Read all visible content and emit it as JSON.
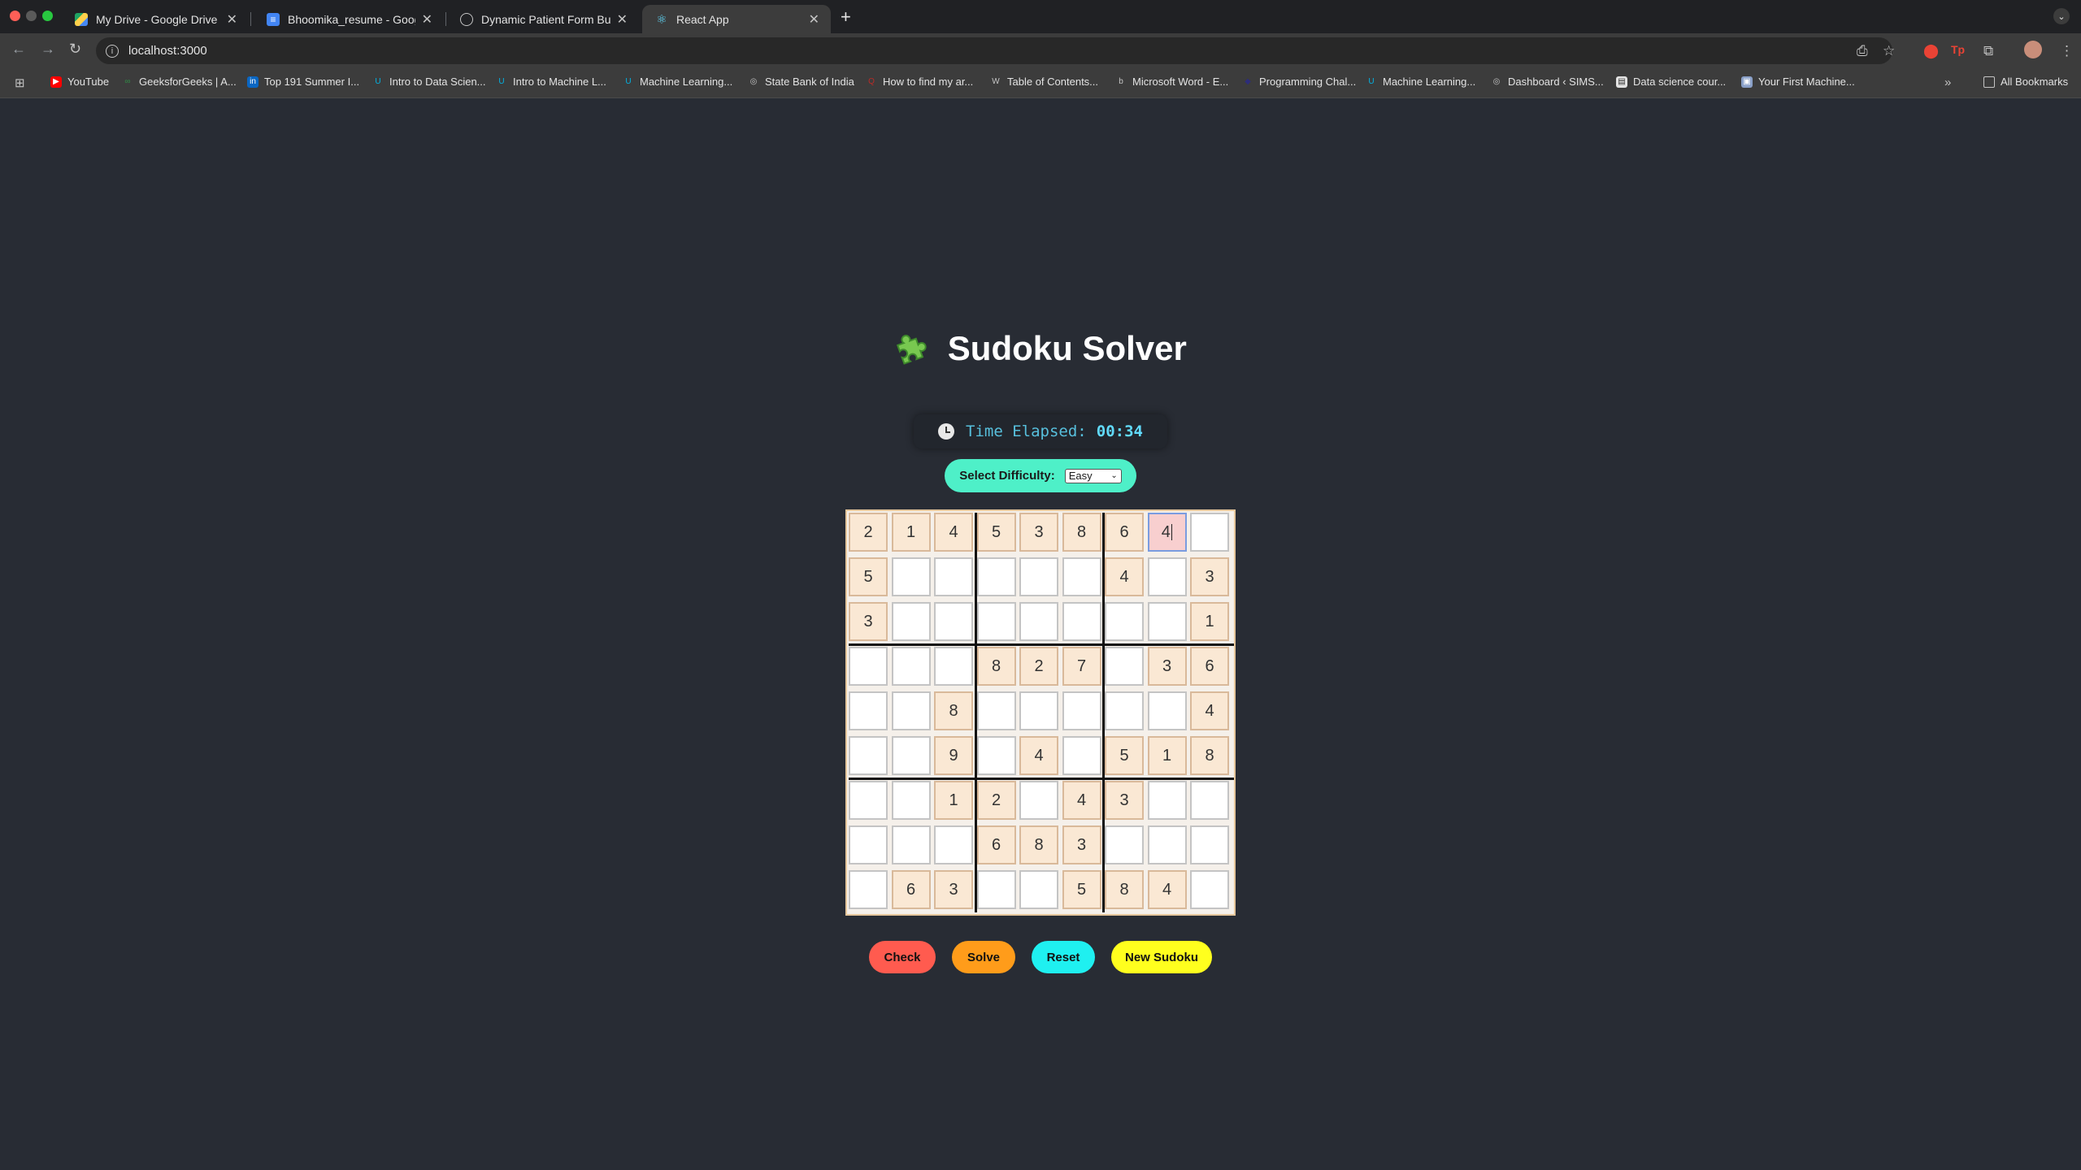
{
  "browser": {
    "tabs": [
      {
        "title": "My Drive - Google Drive",
        "icon": "google-drive-icon"
      },
      {
        "title": "Bhoomika_resume - Google D",
        "icon": "google-docs-icon"
      },
      {
        "title": "Dynamic Patient Form Builder",
        "icon": "globe-icon"
      },
      {
        "title": "React App",
        "icon": "react-icon",
        "active": true
      }
    ],
    "url": "localhost:3000",
    "bookmarks": [
      {
        "label": "YouTube",
        "icon": "youtube-icon"
      },
      {
        "label": "GeeksforGeeks | A...",
        "icon": "gfg-icon"
      },
      {
        "label": "Top 191 Summer I...",
        "icon": "linkedin-icon"
      },
      {
        "label": "Intro to Data Scien...",
        "icon": "udacity-icon"
      },
      {
        "label": "Intro to Machine L...",
        "icon": "udacity-icon"
      },
      {
        "label": "Machine Learning...",
        "icon": "udacity-icon"
      },
      {
        "label": "State Bank of India",
        "icon": "globe-icon"
      },
      {
        "label": "How to find my ar...",
        "icon": "quora-icon"
      },
      {
        "label": "Table of Contents...",
        "icon": "wordpress-icon"
      },
      {
        "label": "Microsoft Word - E...",
        "icon": "pdf-icon"
      },
      {
        "label": "Programming Chal...",
        "icon": "hackerrank-icon"
      },
      {
        "label": "Machine Learning...",
        "icon": "udacity-icon"
      },
      {
        "label": "Dashboard ‹ SIMS...",
        "icon": "globe-icon"
      },
      {
        "label": "Data science cour...",
        "icon": "doc-icon"
      },
      {
        "label": "Your First Machine...",
        "icon": "image-icon"
      }
    ],
    "all_bookmarks": "All Bookmarks"
  },
  "app": {
    "title": "Sudoku Solver",
    "timer_label": "Time Elapsed:",
    "timer_value": "00:34",
    "difficulty_label": "Select Difficulty:",
    "difficulty_value": "Easy",
    "grid": [
      [
        2,
        1,
        4,
        5,
        3,
        8,
        6,
        4,
        0
      ],
      [
        5,
        0,
        0,
        0,
        0,
        0,
        4,
        0,
        3
      ],
      [
        3,
        0,
        0,
        0,
        0,
        0,
        0,
        0,
        1
      ],
      [
        0,
        0,
        0,
        8,
        2,
        7,
        0,
        3,
        6
      ],
      [
        0,
        0,
        8,
        0,
        0,
        0,
        0,
        0,
        4
      ],
      [
        0,
        0,
        9,
        0,
        4,
        0,
        5,
        1,
        8
      ],
      [
        0,
        0,
        1,
        2,
        0,
        4,
        3,
        0,
        0
      ],
      [
        0,
        0,
        0,
        6,
        8,
        3,
        0,
        0,
        0
      ],
      [
        0,
        6,
        3,
        0,
        0,
        5,
        8,
        4,
        0
      ]
    ],
    "active_cell": {
      "row": 0,
      "col": 7
    },
    "buttons": {
      "check": "Check",
      "solve": "Solve",
      "reset": "Reset",
      "new": "New Sudoku"
    },
    "colors": {
      "background": "#282c34",
      "timer_text": "#61dafb",
      "difficulty_bg": "#4ef0c8",
      "given_cell": "#fae8d4",
      "check_btn": "#ff5b4f",
      "solve_btn": "#ff9c1a",
      "reset_btn": "#1ff0f0",
      "new_btn": "#ffff1e"
    }
  }
}
